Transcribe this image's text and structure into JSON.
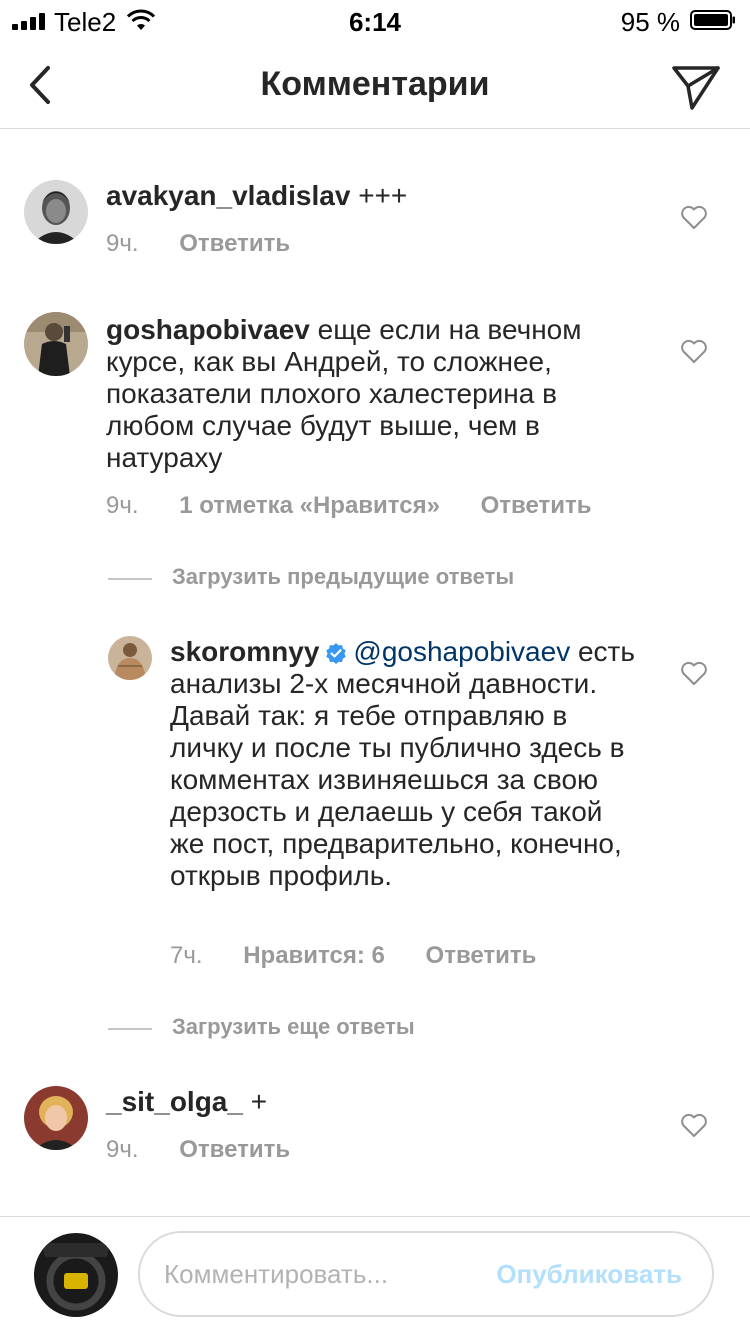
{
  "status_bar": {
    "carrier": "Tele2",
    "time": "6:14",
    "battery": "95 %"
  },
  "nav": {
    "title": "Комментарии",
    "back_icon": "chevron-left-icon",
    "direct_icon": "paper-plane-icon"
  },
  "comments": [
    {
      "username": "avakyan_vladislav",
      "text": " +++",
      "time": "9ч.",
      "reply": "Ответить"
    },
    {
      "username": "goshapobivaev",
      "text": " еще если на вечном курсе, как вы Андрей, то сложнее, показатели плохого халестерина в любом случае будут выше, чем в натураху",
      "time": "9ч.",
      "likes": "1 отметка «Нравится»",
      "reply": "Ответить"
    }
  ],
  "load_previous": "Загрузить предыдущие ответы",
  "reply_comment": {
    "username": "skoromnyy",
    "mention": "@goshapobivaev",
    "text": " есть анализы 2-х месячной давности. Давай так: я тебе отправляю в личку и после ты публично здесь в комментах извиняешься за свою дерзость и делаешь у себя такой же пост, предварительно, конечно, открыв профиль.",
    "time": "7ч.",
    "likes": "Нравится: 6",
    "reply": "Ответить"
  },
  "load_more": "Загрузить еще ответы",
  "last_comment": {
    "username": "_sit_olga_",
    "text": " +",
    "time": "9ч.",
    "reply": "Ответить"
  },
  "composer": {
    "placeholder": "Комментировать...",
    "publish": "Опубликовать"
  },
  "colors": {
    "text": "#262626",
    "meta": "#999999",
    "mention": "#003569",
    "verified": "#3897f0",
    "publish_disabled": "#b2dffc"
  }
}
